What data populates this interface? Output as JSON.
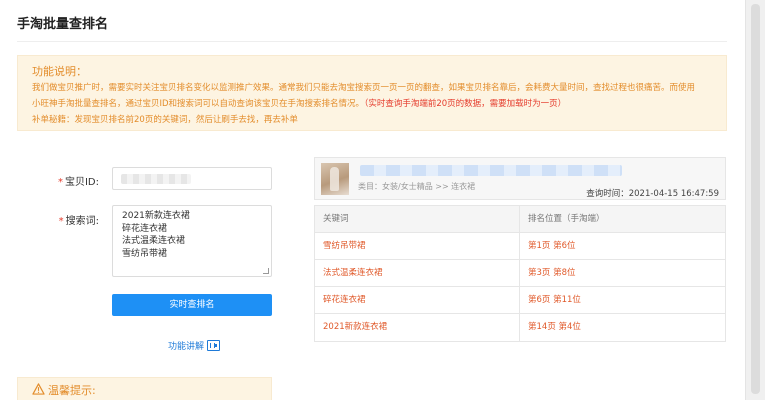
{
  "page": {
    "title": "手淘批量查排名"
  },
  "notice": {
    "heading": "功能说明：",
    "line1": "我们做宝贝推广时，需要实时关注宝贝排名变化以监测推广效果。通常我们只能去淘宝搜索页一页一页的翻查，如果宝贝排名靠后，会耗费大量时间，查找过程也很痛苦。而使用",
    "line2_main": "小旺神手淘批量查排名，通过宝贝ID和搜索词可以自动查询该宝贝在手淘搜索排名情况。",
    "line2_highlight": "（实时查询手淘端前20页的数据，需要加载时为一页）",
    "line3": "补单秘籍：发现宝贝排名前20页的关键词，然后让刷手去找，再去补单"
  },
  "form": {
    "id_label": "宝贝ID:",
    "keyword_label": "搜索词:",
    "required_mark": "*",
    "keywords": [
      "2021新款连衣裙",
      "碎花连衣裙",
      "法式温柔连衣裙",
      "雪纺吊带裙"
    ],
    "submit_label": "实时查排名",
    "help_link": "功能讲解"
  },
  "tip": {
    "label": "温馨提示:"
  },
  "product": {
    "category": "类目：女装/女士精品 >> 连衣裙",
    "query_time": "查询时间：2021-04-15 16:47:59"
  },
  "results": {
    "headers": [
      "关键词",
      "排名位置（手淘端）"
    ],
    "rows": [
      {
        "keyword": "雪纺吊带裙",
        "position": "第1页 第6位"
      },
      {
        "keyword": "法式温柔连衣裙",
        "position": "第3页 第8位"
      },
      {
        "keyword": "碎花连衣裙",
        "position": "第6页 第11位"
      },
      {
        "keyword": "2021新款连衣裙",
        "position": "第14页 第4位"
      }
    ]
  },
  "colors": {
    "accent_blue": "#1e90f5",
    "notice_orange": "#e38d2c",
    "alert_red": "#e53b2c",
    "result_red": "#e05a2b"
  }
}
